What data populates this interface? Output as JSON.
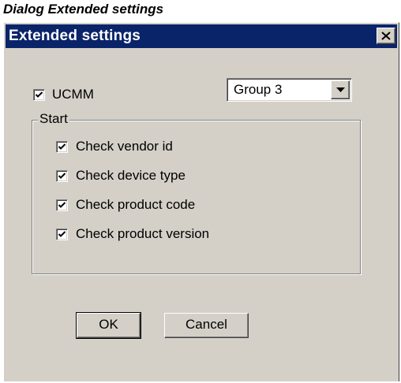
{
  "caption": "Dialog Extended settings",
  "dialog": {
    "title": "Extended settings",
    "close_symbol": "close-icon"
  },
  "ucmm": {
    "label": "UCMM",
    "checked": true
  },
  "group_select": {
    "selected": "Group 3"
  },
  "start_group": {
    "legend": "Start",
    "options": [
      {
        "label": "Check vendor id",
        "checked": true
      },
      {
        "label": "Check device type",
        "checked": true
      },
      {
        "label": "Check product code",
        "checked": true
      },
      {
        "label": "Check product version",
        "checked": true
      }
    ]
  },
  "buttons": {
    "ok_label": "OK",
    "cancel_label": "Cancel"
  },
  "colors": {
    "titlebar": "#0a246a",
    "face": "#d4d0c8"
  }
}
